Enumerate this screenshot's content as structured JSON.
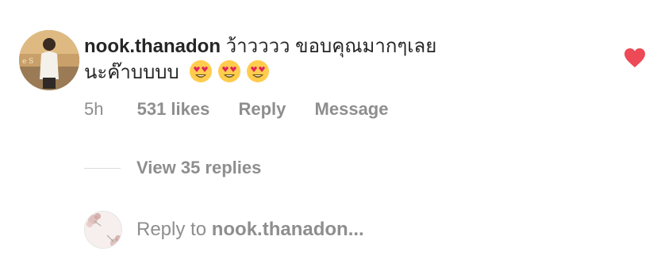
{
  "comment": {
    "username": "nook.thanadon",
    "text_line1": "ว้าวววว ขอบคุณมากๆเลย",
    "text_line2": "นะค๊าบบบบ",
    "emoji_icons": [
      "heart-eyes-emoji",
      "heart-eyes-emoji",
      "heart-eyes-emoji"
    ],
    "liked": true,
    "heart_color": "#ed4956"
  },
  "meta": {
    "time": "5h",
    "likes": "531 likes",
    "reply": "Reply",
    "message": "Message"
  },
  "replies": {
    "view_label": "View 35 replies"
  },
  "reply_box": {
    "prefix": "Reply to ",
    "target": "nook.thanadon..."
  },
  "colors": {
    "text_primary": "#262626",
    "text_secondary": "#8e8e8e",
    "divider": "#dbdbdb"
  }
}
